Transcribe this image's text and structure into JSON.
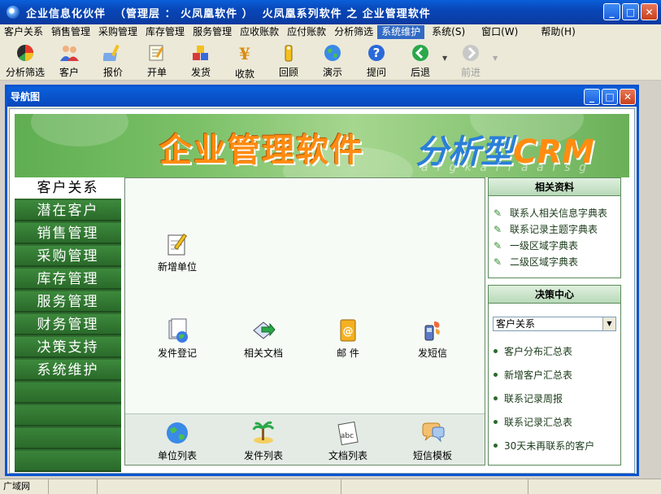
{
  "window": {
    "title": "企业信息化伙伴  （管理层 ： 火凤凰软件 ）  火凤凰系列软件 之 企业管理软件",
    "minimize": "_",
    "maximize": "□",
    "close": "✕"
  },
  "menubar": {
    "items": [
      "客户关系",
      "销售管理",
      "采购管理",
      "库存管理",
      "服务管理",
      "应收账款",
      "应付账款",
      "分析筛选",
      "系统维护",
      "系统(S)",
      "窗口(W)",
      "帮助(H)"
    ],
    "active_index": 8
  },
  "toolbar": {
    "buttons": [
      {
        "label": "分析筛选",
        "icon": "analysis-icon",
        "enabled": true
      },
      {
        "label": "客户",
        "icon": "customers-icon",
        "enabled": true
      },
      {
        "label": "报价",
        "icon": "quote-icon",
        "enabled": true
      },
      {
        "label": "开单",
        "icon": "order-icon",
        "enabled": true
      },
      {
        "label": "发货",
        "icon": "shipping-icon",
        "enabled": true
      },
      {
        "label": "收款",
        "icon": "yen-icon",
        "enabled": true
      },
      {
        "label": "回顾",
        "icon": "review-icon",
        "enabled": true
      },
      {
        "label": "演示",
        "icon": "globe-icon",
        "enabled": true
      },
      {
        "label": "提问",
        "icon": "help-icon",
        "enabled": true
      },
      {
        "label": "后退",
        "icon": "back-arrow-icon",
        "enabled": true
      },
      {
        "label": "前进",
        "icon": "forward-arrow-icon",
        "enabled": false
      }
    ]
  },
  "child_window": {
    "title": "导航图"
  },
  "banner": {
    "main": "企业管理软件",
    "sub_prefix": "分析型",
    "sub_suffix": "CRM",
    "faint": "a f g k a f r a a f s g"
  },
  "leftnav": {
    "items": [
      "客户关系",
      "潜在客户",
      "销售管理",
      "采购管理",
      "库存管理",
      "服务管理",
      "财务管理",
      "决策支持",
      "系统维护"
    ],
    "active_index": 0
  },
  "center": {
    "top_functions": [
      {
        "label": "新增单位",
        "icon": "new-unit-icon"
      },
      {
        "label": "发件登记",
        "icon": "dispatch-register-icon"
      },
      {
        "label": "相关文档",
        "icon": "related-docs-icon"
      },
      {
        "label": "邮  件",
        "icon": "mail-icon"
      },
      {
        "label": "发短信",
        "icon": "sms-icon"
      }
    ],
    "bottom_functions": [
      {
        "label": "单位列表",
        "icon": "unit-list-icon"
      },
      {
        "label": "发件列表",
        "icon": "dispatch-list-icon"
      },
      {
        "label": "文档列表",
        "icon": "doc-list-icon"
      },
      {
        "label": "短信模板",
        "icon": "sms-template-icon"
      }
    ]
  },
  "related_info": {
    "title": "相关资料",
    "items": [
      "联系人相关信息字典表",
      "联系记录主题字典表",
      "一级区域字典表",
      "二级区域字典表"
    ]
  },
  "decision_center": {
    "title": "决策中心",
    "select_value": "客户关系",
    "items": [
      "客户分布汇总表",
      "新增客户汇总表",
      "联系记录周报",
      "联系记录汇总表",
      "30天未再联系的客户"
    ]
  },
  "statusbar": {
    "cells": [
      "广域网",
      "",
      "",
      "",
      ""
    ]
  },
  "colors": {
    "title_blue": "#0a50c8",
    "nav_green": "#2f6c2f",
    "banner_orange": "#ff8c10",
    "banner_blue": "#2a7fd8",
    "menu_highlight": "#316ac5"
  }
}
